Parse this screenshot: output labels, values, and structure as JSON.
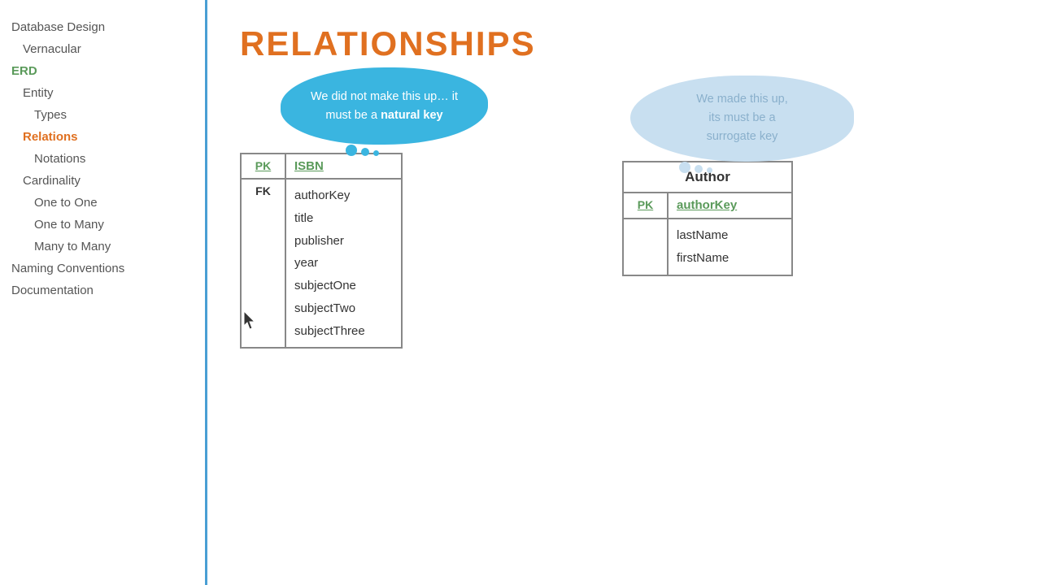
{
  "sidebar": {
    "items": [
      {
        "label": "Database Design",
        "class": "sidebar-item",
        "indent": 0
      },
      {
        "label": "Vernacular",
        "class": "sidebar-item indent1",
        "indent": 1
      },
      {
        "label": "ERD",
        "class": "sidebar-item erd",
        "indent": 0
      },
      {
        "label": "Entity",
        "class": "sidebar-item indent1",
        "indent": 1
      },
      {
        "label": "Types",
        "class": "sidebar-item indent2",
        "indent": 2
      },
      {
        "label": "Relations",
        "class": "sidebar-item indent1 active",
        "indent": 1
      },
      {
        "label": "Notations",
        "class": "sidebar-item indent2",
        "indent": 2
      },
      {
        "label": "Cardinality",
        "class": "sidebar-item indent1",
        "indent": 1
      },
      {
        "label": "One to One",
        "class": "sidebar-item indent2",
        "indent": 2
      },
      {
        "label": "One to Many",
        "class": "sidebar-item indent2",
        "indent": 2
      },
      {
        "label": "Many to Many",
        "class": "sidebar-item indent2",
        "indent": 2
      },
      {
        "label": "Naming Conventions",
        "class": "sidebar-item",
        "indent": 0
      },
      {
        "label": "Documentation",
        "class": "sidebar-item",
        "indent": 0
      }
    ]
  },
  "page": {
    "title": "RELATIONSHIPS"
  },
  "book_table": {
    "pk_label": "PK",
    "pk_value": "ISBN",
    "fk_label": "FK",
    "fields": [
      "authorKey",
      "title",
      "publisher",
      "year",
      "subjectOne",
      "subjectTwo",
      "subjectThree"
    ]
  },
  "author_table": {
    "title": "Author",
    "pk_label": "PK",
    "pk_value": "authorKey",
    "fields": [
      "lastName",
      "firstName"
    ]
  },
  "bubble_natural": {
    "text_before": "We did not make this up… it must be a ",
    "text_bold": "natural key"
  },
  "bubble_surrogate": {
    "line1": "We made this up,",
    "line2": "its must be a",
    "line3": "surrogate key"
  }
}
